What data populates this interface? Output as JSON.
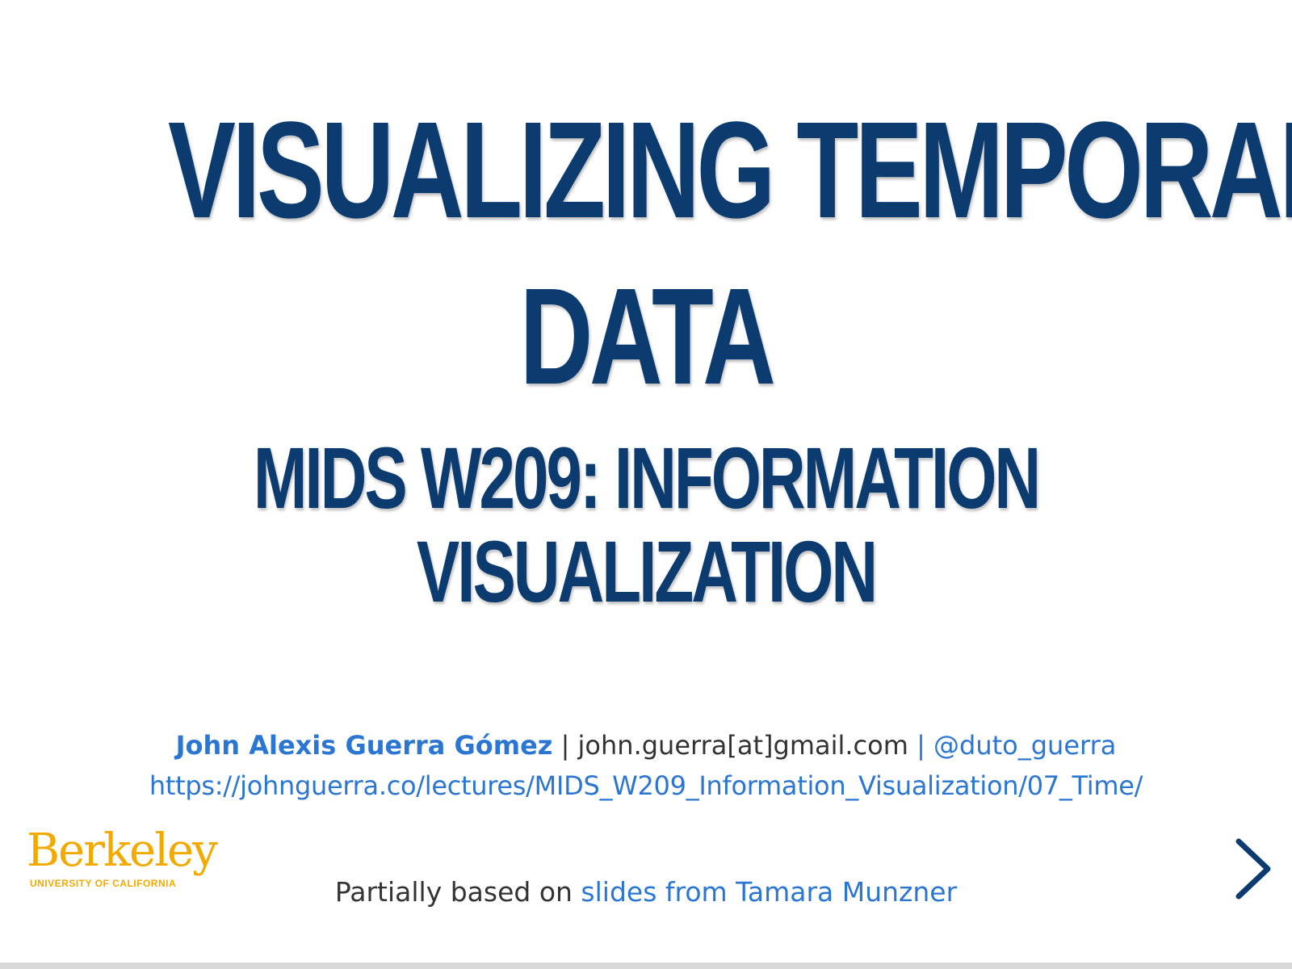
{
  "slide": {
    "title_line1": "VISUALIZING TEMPORAL",
    "title_line2": "DATA",
    "subtitle_line1": "MIDS W209: INFORMATION",
    "subtitle_line2": "VISUALIZATION"
  },
  "byline": {
    "author": "John Alexis Guerra Gómez",
    "separator1": " | ",
    "email": "john.guerra[at]gmail.com",
    "separator2": " | ",
    "handle": "@duto_guerra",
    "url": "https://johnguerra.co/lectures/MIDS_W209_Information_Visualization/07_Time/"
  },
  "credit": {
    "prefix": "Partially based on ",
    "link": "slides from Tamara Munzner"
  },
  "logo": {
    "word": "Berkeley",
    "sub": "UNIVERSITY OF CALIFORNIA"
  },
  "navigation": {
    "next_icon": "chevron-right-icon",
    "progress": 0
  },
  "colors": {
    "title": "#0b3b6f",
    "link": "#2a76d2",
    "logo": "#f2a900",
    "text": "#333333"
  }
}
